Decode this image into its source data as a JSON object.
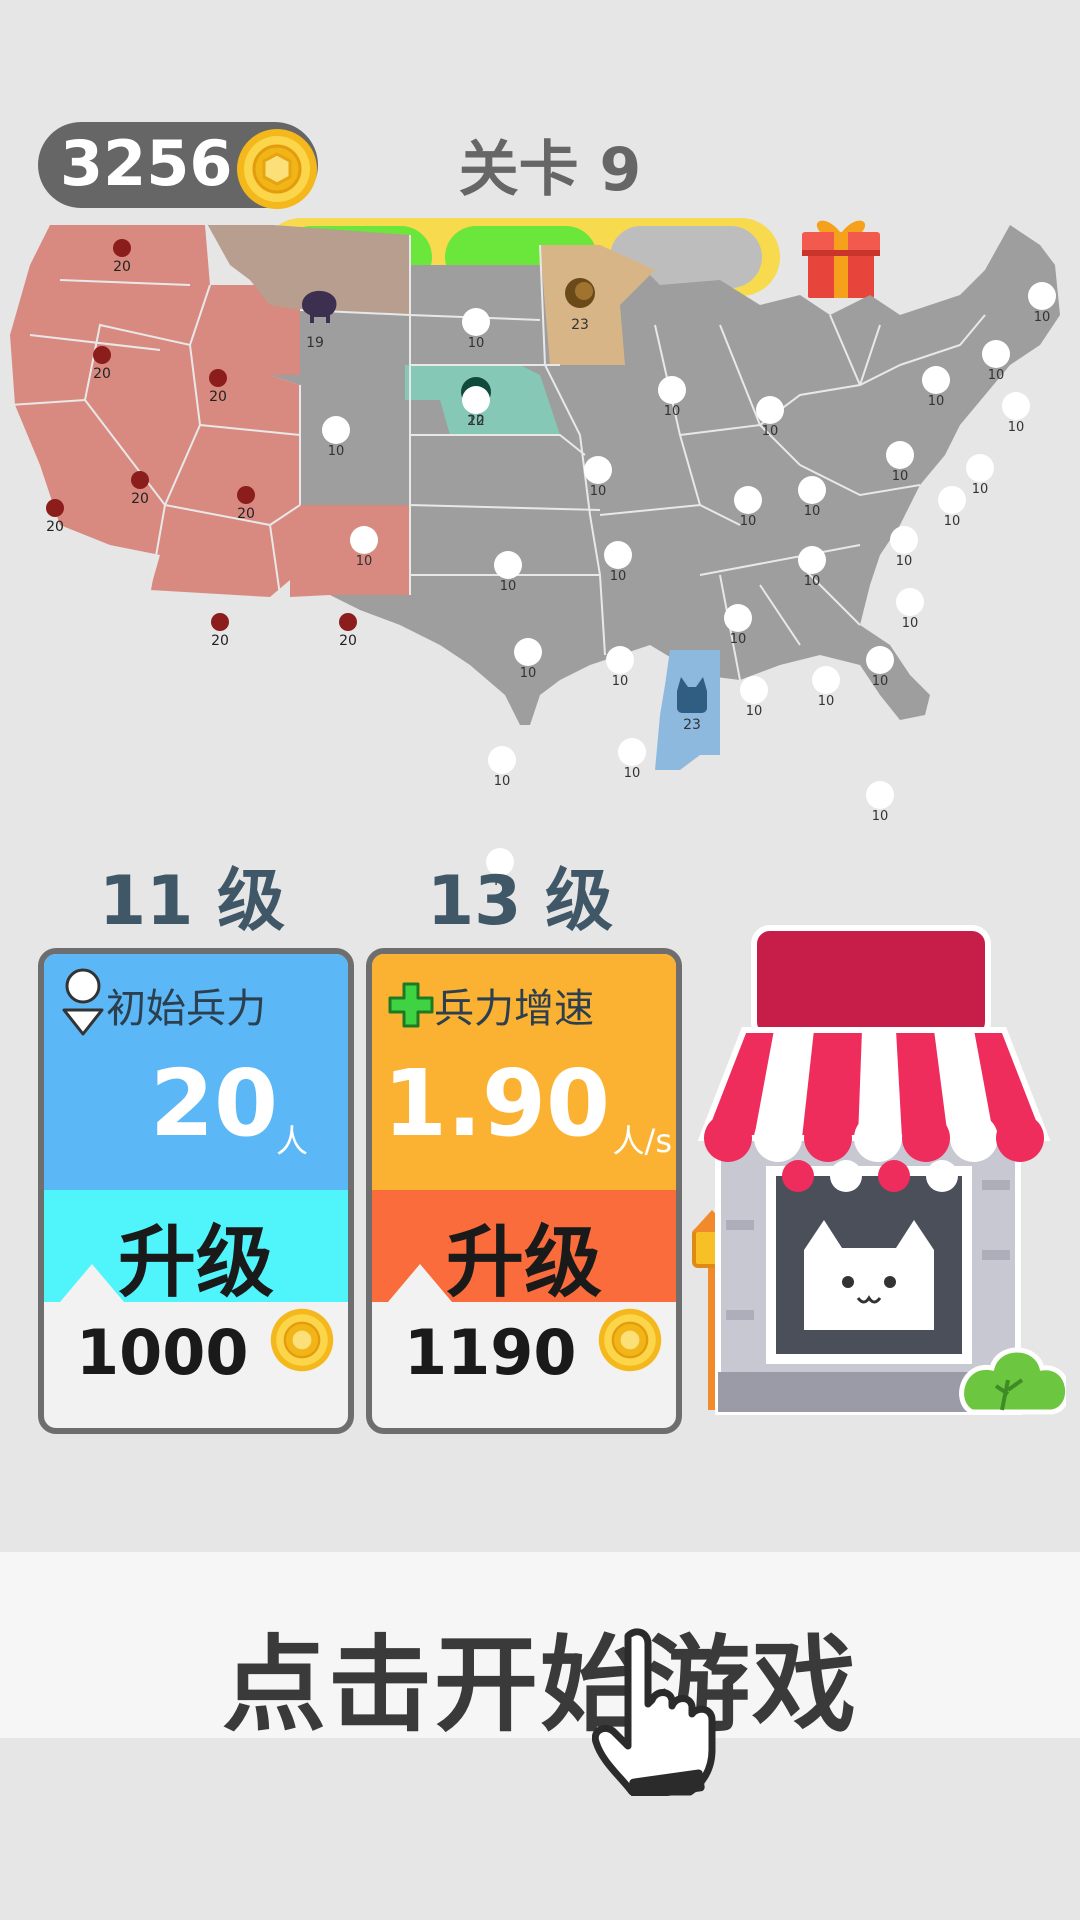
{
  "hud": {
    "coins": "3256",
    "level_title": "关卡 9",
    "progress": {
      "segments_total": 3,
      "segments_filled": 2
    },
    "colors": {
      "filled": "#6be63a",
      "empty": "#bdbdbd",
      "track": "#f7da4e"
    },
    "icons": {
      "coin": "coin-icon",
      "gift": "gift-icon"
    }
  },
  "map": {
    "region": "United States",
    "factions": [
      {
        "icon": "monkey-icon",
        "color": "#d98a80",
        "values": [
          "20",
          "20",
          "20",
          "20",
          "20",
          "20",
          "20",
          "20",
          "20"
        ]
      },
      {
        "icon": "elephant-icon",
        "color": "#b79e8e",
        "values": [
          "19"
        ]
      },
      {
        "icon": "lion-icon",
        "color": "#d7b587",
        "values": [
          "23"
        ]
      },
      {
        "icon": "round-blob-icon",
        "color": "#86c8b6",
        "values": [
          "22"
        ]
      },
      {
        "icon": "cat-icon",
        "color": "#8db9de",
        "values": [
          "23"
        ]
      }
    ],
    "neutral": {
      "color": "#9e9e9e",
      "value": "10"
    }
  },
  "upgrades": [
    {
      "level_label": "11 级",
      "title": "初始兵力",
      "icon": "person-pin-icon",
      "value": "20",
      "unit": "人",
      "button_label": "升级",
      "cost": "1000",
      "top_color": "#5bb7f6",
      "button_color": "#4ff5fb"
    },
    {
      "level_label": "13 级",
      "title": "兵力增速",
      "icon": "plus-icon",
      "value": "1.90",
      "unit": "人/s",
      "button_label": "升级",
      "cost": "1190",
      "top_color": "#fbb233",
      "button_color": "#fa6c3b"
    }
  ],
  "shop": {
    "icon": "shop-cat-icon"
  },
  "start": {
    "label": "点击开始游戏",
    "icon": "tap-hand-icon"
  }
}
